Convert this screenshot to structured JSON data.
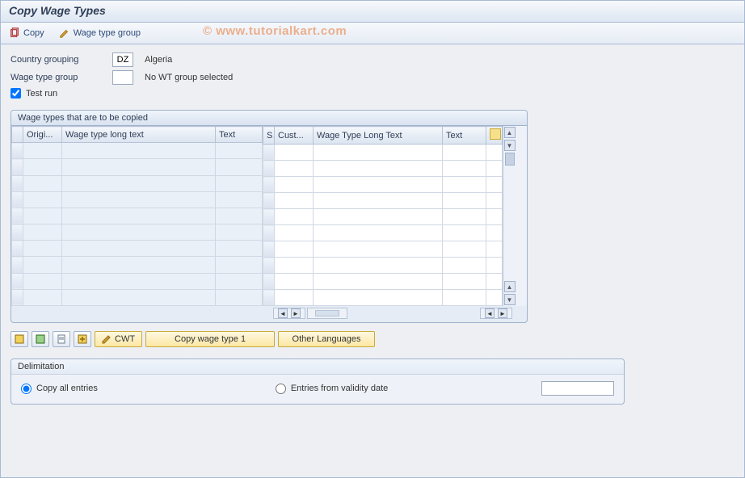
{
  "title": "Copy Wage Types",
  "watermark": "© www.tutorialkart.com",
  "toolbar": {
    "copy_label": "Copy",
    "wage_type_group_label": "Wage type group"
  },
  "form": {
    "country_grouping_label": "Country grouping",
    "country_grouping_value": "DZ",
    "country_grouping_text": "Algeria",
    "wage_type_group_label": "Wage type group",
    "wage_type_group_value": "",
    "wage_type_group_text": "No WT group selected",
    "test_run_label": "Test run",
    "test_run_checked": true
  },
  "table": {
    "title": "Wage types that are to be copied",
    "left_columns": [
      "Origi...",
      "Wage type long text",
      "Text"
    ],
    "right_columns": [
      "S",
      "Cust...",
      "Wage Type Long Text",
      "Text"
    ],
    "row_count": 10
  },
  "actions": {
    "cwt_label": "CWT",
    "copy_wage_type_label": "Copy wage type 1",
    "other_languages_label": "Other Languages"
  },
  "delimitation": {
    "group_title": "Delimitation",
    "copy_all_label": "Copy all entries",
    "entries_from_label": "Entries from validity date",
    "selected": "copy_all",
    "date_value": ""
  }
}
